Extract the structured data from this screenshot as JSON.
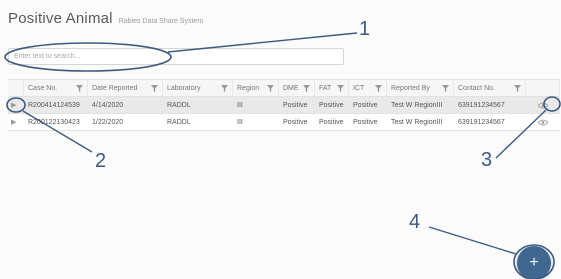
{
  "app": {
    "title": "Positive Animal",
    "subtitle": "Rabies Data Share System"
  },
  "search": {
    "placeholder": "Enter text to search..."
  },
  "table": {
    "columns": [
      "Case No.",
      "Date Reported",
      "Laboratory",
      "Region",
      "DME",
      "FAT",
      "ICT",
      "Reported By",
      "Contact No."
    ],
    "rows": [
      [
        "R200414124539",
        "4/14/2020",
        "RADDL",
        "III",
        "Positive",
        "Positive",
        "Positive",
        "Test W RegionIII",
        "639191234567"
      ],
      [
        "R200122130423",
        "1/22/2020",
        "RADDL",
        "III",
        "Positive",
        "Positive",
        "Positive",
        "Test W RegionIII",
        "639191234567"
      ]
    ]
  },
  "fab": {
    "label": "+"
  },
  "callouts": [
    "1",
    "2",
    "3",
    "4"
  ],
  "icons": {
    "expand": "chevron-right-icon",
    "filter": "filter-funnel-icon",
    "view": "eye-icon",
    "add": "plus-icon"
  },
  "colors": {
    "accent": "#3f6790",
    "callout": "#3d5a80",
    "selected_row": "#e9e9e9"
  }
}
